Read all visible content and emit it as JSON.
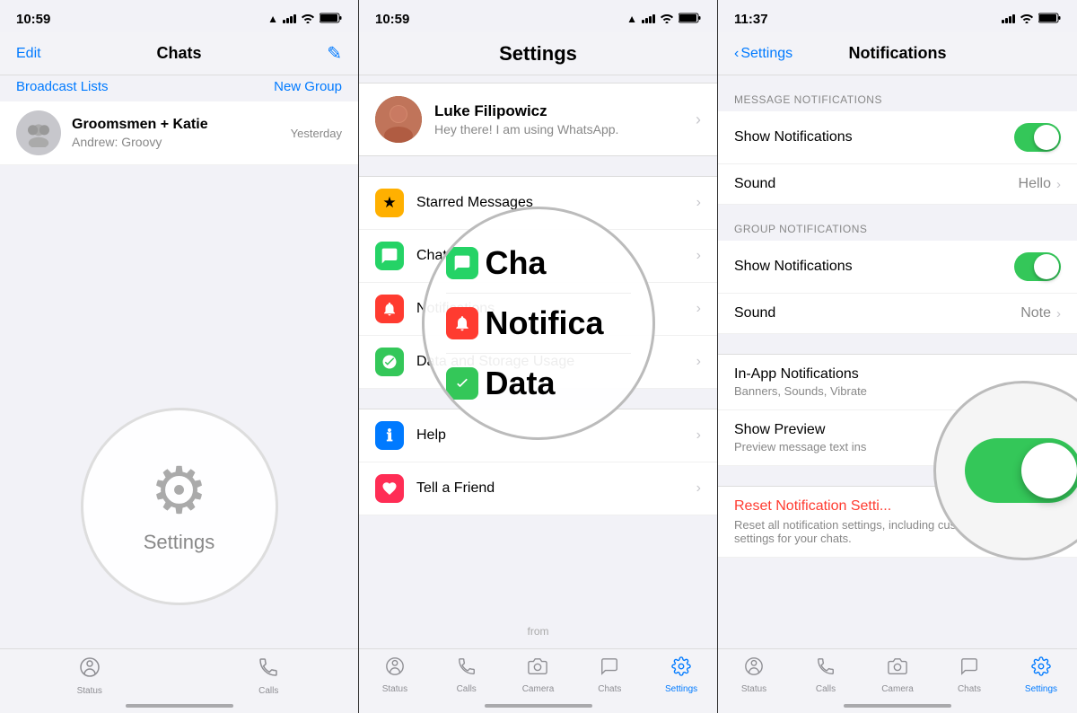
{
  "left_panel": {
    "status_bar": {
      "time": "10:59",
      "location_icon": "▲",
      "signal": "●●●●",
      "wifi": "WiFi",
      "battery": "Battery"
    },
    "nav": {
      "edit": "Edit",
      "title": "Chats",
      "compose_icon": "✏️"
    },
    "links": {
      "broadcast": "Broadcast Lists",
      "new_group": "New Group"
    },
    "chat_item": {
      "name": "Groomsmen + Katie",
      "preview": "Andrew: Groovy",
      "time": "Yesterday"
    },
    "circle_overlay": {
      "text": "Settings"
    },
    "tab_bar": {
      "status": "Status",
      "calls": "Calls"
    }
  },
  "middle_panel": {
    "status_bar": {
      "time": "10:59"
    },
    "nav": {
      "title": "Settings"
    },
    "profile": {
      "name": "Luke Filipowicz",
      "status": "Hey there! I am using WhatsApp."
    },
    "menu_items": [
      {
        "icon_color": "#FFB000",
        "icon_char": "★",
        "label": "Starred Messages"
      },
      {
        "icon_color": "#25D366",
        "icon_char": "💬",
        "label": "Chats"
      },
      {
        "icon_color": "#FF3B30",
        "icon_char": "🔔",
        "label": "Notifications"
      },
      {
        "icon_color": "#34C759",
        "icon_char": "📊",
        "label": "Data and Storage Usage"
      }
    ],
    "help_items": [
      {
        "icon_color": "#007AFF",
        "icon_char": "ℹ",
        "label": "Help"
      },
      {
        "icon_color": "#FF2D55",
        "icon_char": "♥",
        "label": "Tell a Friend"
      }
    ],
    "circle_labels": {
      "chats": "Cha",
      "notifications": "Notifica",
      "data": "Data"
    },
    "from_label": "from",
    "tab_bar": {
      "status": "Status",
      "calls": "Calls",
      "camera": "Camera",
      "chats": "Chats",
      "settings": "Settings"
    }
  },
  "right_panel": {
    "status_bar": {
      "time": "11:37"
    },
    "nav": {
      "back": "Settings",
      "title": "Notifications"
    },
    "message_notifications": {
      "section_header": "MESSAGE NOTIFICATIONS",
      "show_notifications": "Show Notifications",
      "show_toggle": true,
      "sound_label": "Sound",
      "sound_value": "Hello"
    },
    "group_notifications": {
      "section_header": "GROUP NOTIFICATIONS",
      "show_notifications": "Show Notifications",
      "show_toggle": true,
      "sound_label": "Sound",
      "sound_value": "Note"
    },
    "in_app": {
      "label": "In-App Notifications",
      "sublabel": "Banners, Sounds, Vibrate"
    },
    "show_preview": {
      "label": "Show Preview",
      "toggle": true,
      "sublabel": "Preview message text ins"
    },
    "reset": {
      "label": "Reset Notification Setti...",
      "desc": "Reset all notification settings, including custom notification settings for your chats."
    },
    "tab_bar": {
      "status": "Status",
      "calls": "Calls",
      "camera": "Camera",
      "chats": "Chats",
      "settings": "Settings"
    }
  }
}
